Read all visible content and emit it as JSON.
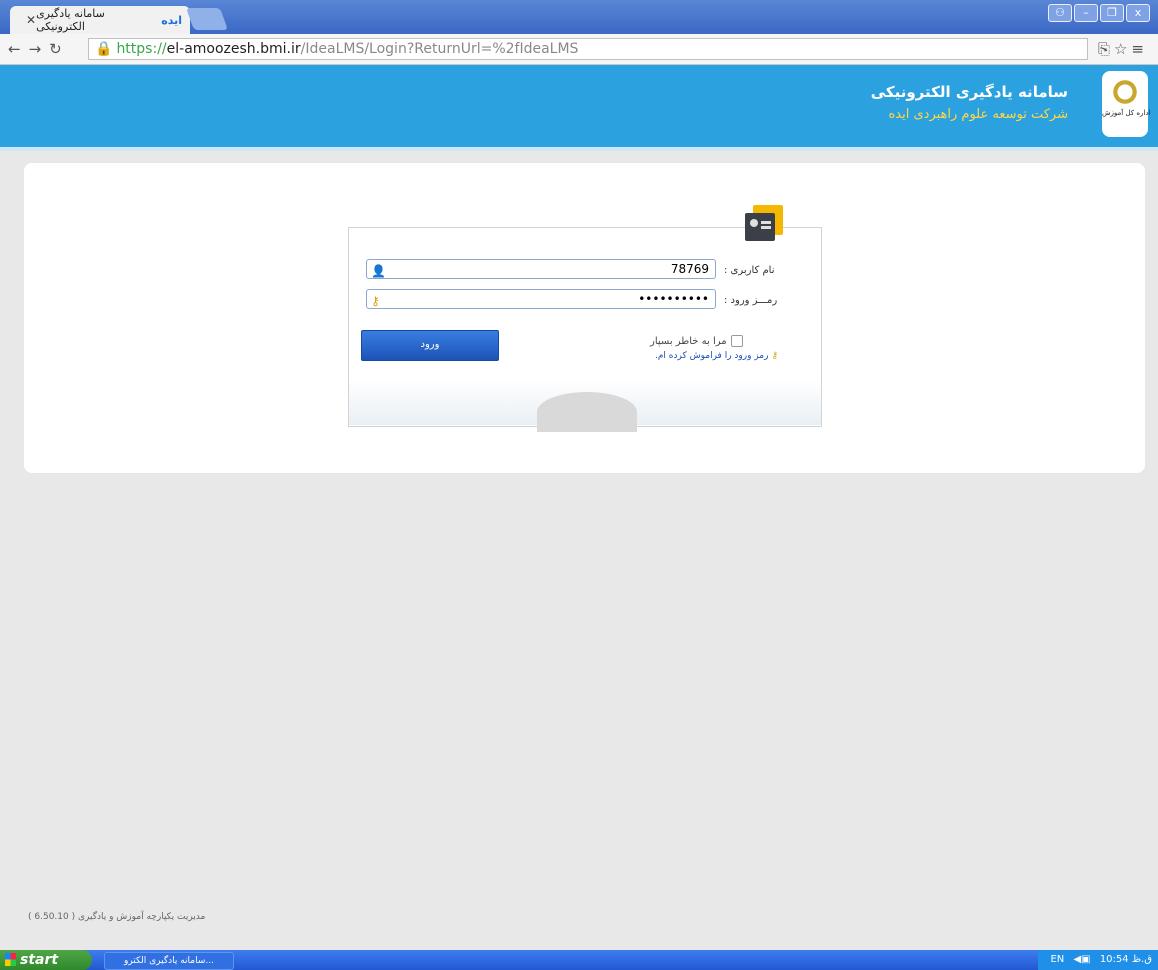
{
  "browser": {
    "tab_title": "سامانه یادگیری الکترونیکی",
    "tab_badge": "ایده",
    "url_scheme": "https",
    "url_host": "el-amoozesh.bmi.ir",
    "url_path": "/IdeaLMS/Login?ReturnUrl=%2fIdeaLMS"
  },
  "header": {
    "title": "سامانه یادگیری الکترونیکی",
    "subtitle": "شرکت توسعه علوم راهبردی ایده",
    "logo_caption": "اداره کل آموزش"
  },
  "login": {
    "username_label": "نام کاربری :",
    "username_value": "78769",
    "password_label": "رمـــز ورود :",
    "password_value": "••••••••••",
    "remember_label": "مرا به خاطر بسپار",
    "forgot_link": "رمز ورود را فراموش کرده ام.",
    "submit_label": "ورود"
  },
  "footer": {
    "version_text": "مدیریت یکپارچه آموزش و یادگیری ( 6.50.10 )"
  },
  "taskbar": {
    "start_label": "start",
    "task_label": "...سامانه یادگیری الکترو",
    "lang": "EN",
    "clock": "10:54 ق.ظ"
  },
  "colors": {
    "header_bg": "#2ba2df",
    "subtitle_color": "#ffd54a",
    "button_blue": "#1c53b8",
    "link_blue": "#1a4fb5"
  }
}
